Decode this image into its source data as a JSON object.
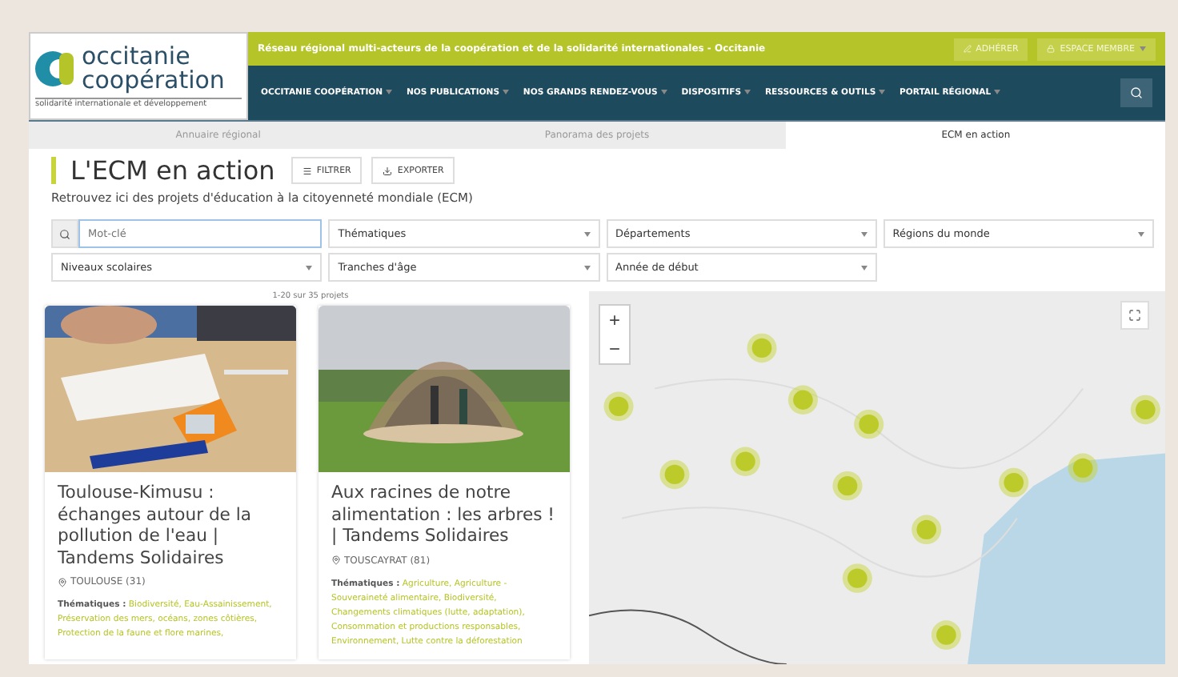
{
  "logo": {
    "line1": "occitanie",
    "line2": "coopération",
    "tagline": "solidarité internationale et développement"
  },
  "banner": {
    "text": "Réseau régional multi-acteurs de la coopération et de la solidarité internationales - Occitanie",
    "actions": [
      "ADHÉRER",
      "ESPACE MEMBRE"
    ]
  },
  "nav": [
    "OCCITANIE COOPÉRATION",
    "NOS PUBLICATIONS",
    "NOS GRANDS RENDEZ-VOUS",
    "DISPOSITIFS",
    "RESSOURCES & OUTILS",
    "PORTAIL RÉGIONAL"
  ],
  "tabs": [
    {
      "label": "Annuaire régional",
      "selected": false
    },
    {
      "label": "Panorama des projets",
      "selected": false
    },
    {
      "label": "ECM en action",
      "selected": true
    }
  ],
  "title": "L'ECM en action",
  "buttons": [
    "FILTRER",
    "EXPORTER"
  ],
  "subtitle": "Retrouvez ici des projets d'éducation à la citoyenneté mondiale (ECM)",
  "search": {
    "placeholder": "Mot-clé"
  },
  "filters": [
    [
      "Thématiques",
      "Départements",
      "Régions du monde"
    ],
    [
      "Niveaux scolaires",
      "Tranches d'âge",
      "Année de début"
    ]
  ],
  "count": "1-20 sur 35 projets",
  "cards": [
    {
      "title": "Toulouse-Kimusu : échanges autour de la pollution de l'eau | Tandems Solidaires",
      "place": "TOULOUSE (31)",
      "themes_label": "Thématiques :",
      "themes": "Biodiversité, Eau-Assainissement, Préservation des mers, océans, zones côtières, Protection de la faune et flore marines,"
    },
    {
      "title": "Aux racines de notre alimentation : les arbres ! | Tandems Solidaires",
      "place": "TOUSCAYRAT (81)",
      "themes_label": "Thématiques :",
      "themes": "Agriculture, Agriculture - Souveraineté alimentaire, Biodiversité, Changements climatiques (lutte, adaptation), Consommation et productions responsables, Environnement, Lutte contre la déforestation"
    }
  ],
  "map": {
    "zoom": [
      "+",
      "−"
    ]
  }
}
